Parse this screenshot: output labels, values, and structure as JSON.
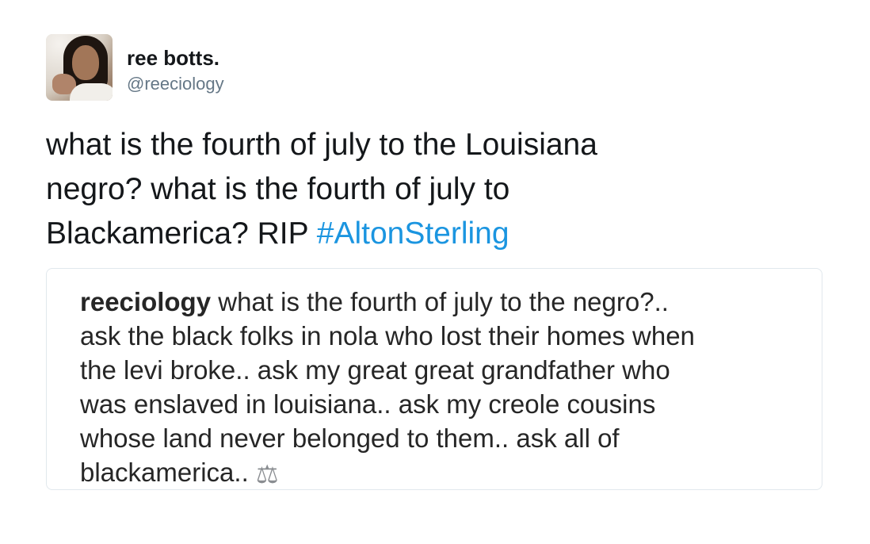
{
  "tweet": {
    "display_name": "ree botts.",
    "handle": "@reeciology",
    "text_line_1": "what is the fourth of july to the Louisiana",
    "text_line_2": "negro? what is the fourth of july to",
    "text_line_3_prefix": "Blackamerica? RIP ",
    "hashtag": "#AltonSterling"
  },
  "quote": {
    "username": "reeciology",
    "line_1": " what is the fourth of july to the negro?..",
    "line_2": "ask the black folks in nola who lost their homes when",
    "line_3": "the levi broke.. ask my great great grandfather who",
    "line_4": "was enslaved in louisiana.. ask my creole cousins",
    "line_5": "whose land never belonged to them.. ask all of",
    "line_6": "blackamerica.. ",
    "emoji_icon": "scales-icon",
    "emoji_glyph": "⚖"
  },
  "colors": {
    "hashtag": "#1b95e0",
    "handle": "#657786",
    "border": "#e1e8ed"
  }
}
